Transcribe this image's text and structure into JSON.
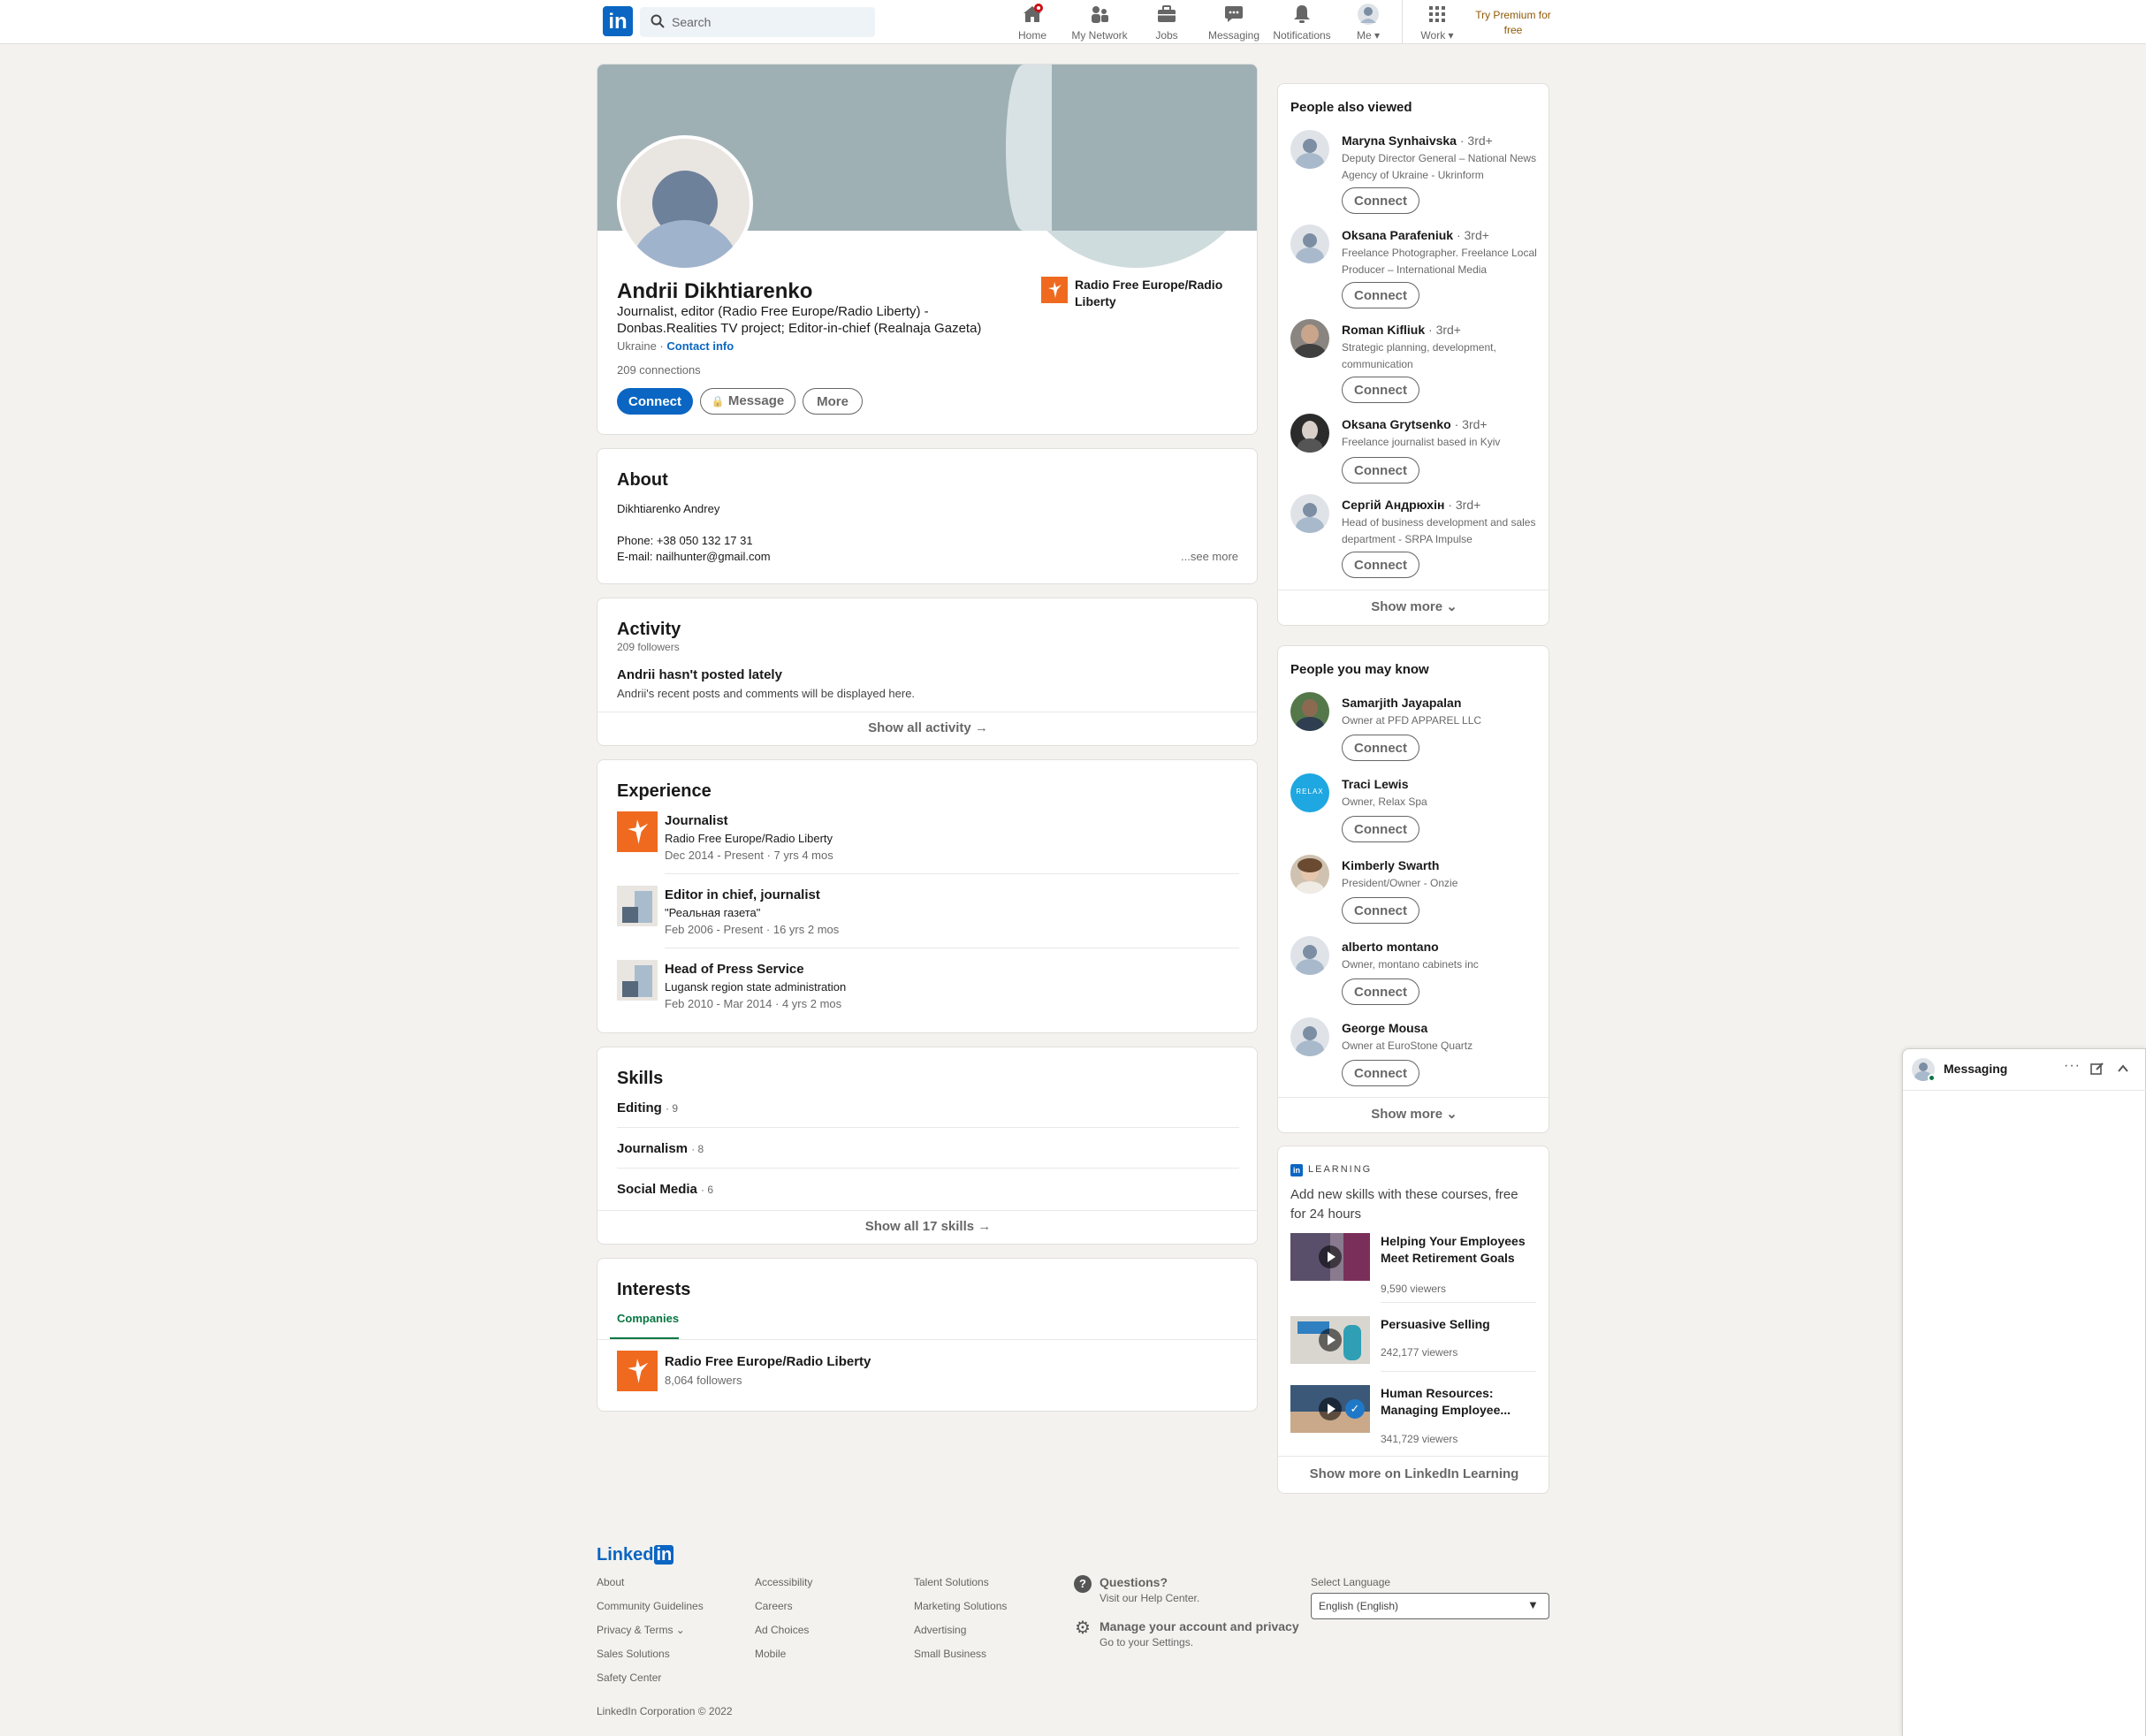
{
  "topbar": {
    "logo": "in",
    "search_placeholder": "Search",
    "nav": [
      {
        "label": "Home",
        "icon": "home-icon",
        "badge": ""
      },
      {
        "label": "My Network",
        "icon": "network-icon"
      },
      {
        "label": "Jobs",
        "icon": "briefcase-icon"
      },
      {
        "label": "Messaging",
        "icon": "messaging-icon"
      },
      {
        "label": "Notifications",
        "icon": "bell-icon"
      },
      {
        "label": "Me",
        "icon": "avatar-icon"
      },
      {
        "label": "Work",
        "icon": "grid-icon"
      }
    ],
    "premium": "Try Premium for free"
  },
  "profile": {
    "name": "Andrii Dikhtiarenko",
    "headline_line1": "Journalist, editor (Radio Free Europe/Radio Liberty) -",
    "headline_line2": "Donbas.Realities TV project; Editor-in-chief (Realnaja Gazeta)",
    "location": "Ukraine ·",
    "contact_info": "Contact info",
    "connections": "209 connections",
    "btn_connect": "Connect",
    "btn_message": "Message",
    "btn_more": "More",
    "company_line1": "Radio Free Europe/Radio",
    "company_line2": "Liberty"
  },
  "about": {
    "title": "About",
    "line1": "Dikhtiarenko Andrey",
    "line2": "Phone: +38 050 132 17 31",
    "line3": "E-mail: nailhunter@gmail.com",
    "see_more": "...see more"
  },
  "activity": {
    "title": "Activity",
    "followers": "209 followers",
    "empty_title": "Andrii hasn't posted lately",
    "empty_sub": "Andrii's recent posts and comments will be displayed here.",
    "show_all": "Show all activity →"
  },
  "experience": {
    "title": "Experience",
    "items": [
      {
        "role": "Journalist",
        "org": "Radio Free Europe/Radio Liberty",
        "dates": "Dec 2014 - Present · 7 yrs 4 mos"
      },
      {
        "role": "Editor in chief, journalist",
        "org": "\"Реальная газета\"",
        "dates": "Feb 2006 - Present · 16 yrs 2 mos"
      },
      {
        "role": "Head of Press Service",
        "org": "Lugansk region state administration",
        "dates": "Feb 2010 - Mar 2014 · 4 yrs 2 mos"
      }
    ]
  },
  "skills": {
    "title": "Skills",
    "items": [
      {
        "name": "Editing",
        "count": "· 9"
      },
      {
        "name": "Journalism",
        "count": "· 8"
      },
      {
        "name": "Social Media",
        "count": "· 6"
      }
    ],
    "show_all": "Show all 17 skills →"
  },
  "interests": {
    "title": "Interests",
    "tab": "Companies",
    "company": "Radio Free Europe/Radio Liberty",
    "followers": "8,064 followers"
  },
  "also_viewed": {
    "title": "People also viewed",
    "people": [
      {
        "name": "Maryna Synhaivska",
        "degree": "· 3rd+",
        "h1": "Deputy Director General – National News",
        "h2": "Agency of Ukraine - Ukrinform"
      },
      {
        "name": "Oksana Parafeniuk",
        "degree": "· 3rd+",
        "h1": "Freelance Photographer. Freelance Local",
        "h2": "Producer – International Media"
      },
      {
        "name": "Roman Kifliuk",
        "degree": "· 3rd+",
        "h1": "Strategic planning, development,",
        "h2": "communication"
      },
      {
        "name": "Oksana Grytsenko",
        "degree": "· 3rd+",
        "h1": "Freelance journalist based in Kyiv",
        "h2": ""
      },
      {
        "name": "Сергій Андрюхін",
        "degree": "· 3rd+",
        "h1": "Head of business development and sales",
        "h2": "department - SRPA Impulse"
      }
    ],
    "connect_label": "Connect",
    "show_more": "Show more ⌄"
  },
  "may_know": {
    "title": "People you may know",
    "people": [
      {
        "name": "Samarjith Jayapalan",
        "h1": "Owner at PFD APPAREL LLC"
      },
      {
        "name": "Traci Lewis",
        "h1": "Owner, Relax Spa"
      },
      {
        "name": "Kimberly Swarth",
        "h1": "President/Owner - Onzie"
      },
      {
        "name": "alberto montano",
        "h1": "Owner, montano cabinets inc"
      },
      {
        "name": "George Mousa",
        "h1": "Owner at EuroStone Quartz"
      }
    ],
    "relax_logo": "RELAX",
    "connect_label": "Connect",
    "show_more": "Show more ⌄"
  },
  "learning": {
    "brand": "LEARNING",
    "brand_mark": "in",
    "intro_line1": "Add new skills with these courses, free",
    "intro_line2": "for 24 hours",
    "courses": [
      {
        "t1": "Helping Your Employees",
        "t2": "Meet Retirement Goals",
        "views": "9,590 viewers"
      },
      {
        "t1": "Persuasive Selling",
        "t2": "",
        "views": "242,177 viewers"
      },
      {
        "t1": "Human Resources:",
        "t2": "Managing Employee...",
        "views": "341,729 viewers"
      }
    ],
    "show_more": "Show more on LinkedIn Learning"
  },
  "footer": {
    "logo_text": "Linked",
    "logo_in": "in",
    "col1": [
      "About",
      "Community Guidelines",
      "Privacy & Terms ⌄",
      "Sales Solutions",
      "Safety Center"
    ],
    "col2": [
      "Accessibility",
      "Careers",
      "Ad Choices",
      "Mobile"
    ],
    "col3": [
      "Talent Solutions",
      "Marketing Solutions",
      "Advertising",
      "Small Business"
    ],
    "questions_title": "Questions?",
    "questions_sub": "Visit our Help Center.",
    "manage_title": "Manage your account and privacy",
    "manage_sub": "Go to your Settings.",
    "lang_label": "Select Language",
    "lang_value": "English (English)",
    "copyright": "LinkedIn Corporation © 2022"
  },
  "messaging": {
    "title": "Messaging"
  },
  "colors": {
    "brand": "#0a66c2",
    "rferl": "#ef6a1f",
    "premium": "#915907",
    "notification_badge": "#cc1016"
  }
}
